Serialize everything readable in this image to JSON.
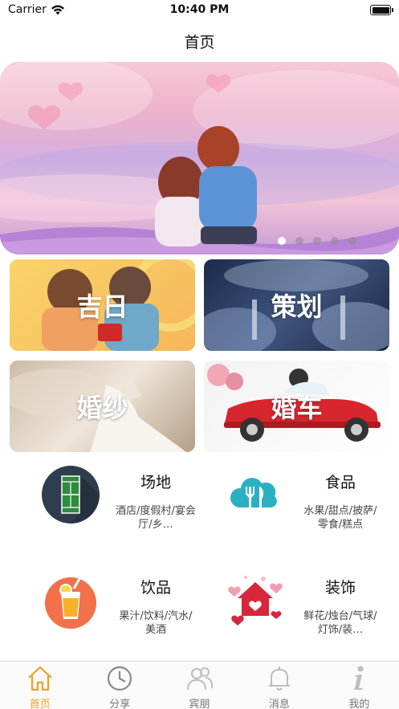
{
  "status_bar": {
    "carrier": "Carrier",
    "time": "10:40 PM"
  },
  "nav": {
    "title": "首页"
  },
  "banner": {
    "page_count": 5,
    "active_index": 0
  },
  "tiles": [
    {
      "label": "吉日"
    },
    {
      "label": "策划"
    },
    {
      "label": "婚纱"
    },
    {
      "label": "婚车"
    }
  ],
  "services": [
    {
      "title": "场地",
      "desc": "酒店/度假村/宴会厅/乡…",
      "icon": "tennis-court-icon"
    },
    {
      "title": "食品",
      "desc": "水果/甜点/披萨/零食/糕点",
      "icon": "cutlery-cloud-icon"
    },
    {
      "title": "饮品",
      "desc": "果汁/饮料/汽水/美酒",
      "icon": "juice-glass-icon"
    },
    {
      "title": "装饰",
      "desc": "鲜花/烛台/气球/灯饰/装…",
      "icon": "heart-house-icon"
    }
  ],
  "tabbar": {
    "items": [
      {
        "label": "首页",
        "icon": "home-icon",
        "active": true
      },
      {
        "label": "分享",
        "icon": "clock-icon",
        "active": false
      },
      {
        "label": "宾朋",
        "icon": "people-icon",
        "active": false
      },
      {
        "label": "消息",
        "icon": "bell-icon",
        "active": false
      },
      {
        "label": "我的",
        "icon": "info-icon",
        "active": false
      }
    ],
    "active_color": "#f0a020",
    "inactive_color": "#777777"
  }
}
